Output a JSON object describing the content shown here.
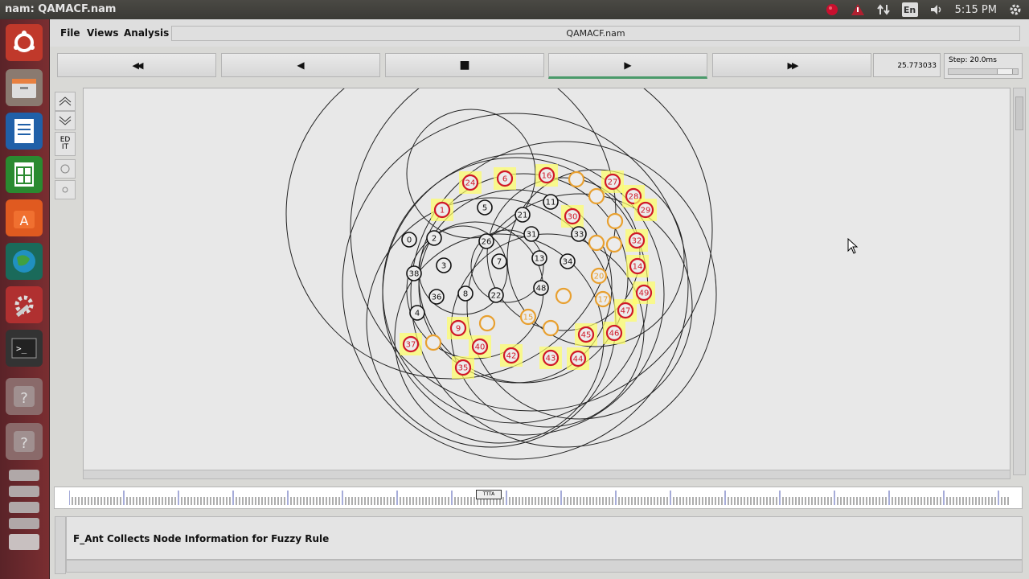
{
  "window_title": "nam: QAMACF.nam",
  "tray": {
    "language": "En",
    "clock": "5:15 PM"
  },
  "menu": {
    "file": "File",
    "views": "Views",
    "analysis": "Analysis"
  },
  "file_name": "QAMACF.nam",
  "controls": {
    "rewind": "◀◀",
    "back": "◀",
    "stop": "■",
    "play": "▶",
    "fast_forward": "▶▶"
  },
  "time_value": "25.773033",
  "step_label": "Step: 20.0ms",
  "tools": {
    "edit": "ED IT"
  },
  "timeline_marker": "TTTA",
  "annotation": "F_Ant Collects Node Information for Fuzzy Rule",
  "colors": {
    "red_node": "#d01828",
    "orange_node": "#e8a030",
    "black_node": "#111111",
    "highlight": "#ffff66",
    "play_active": "#4a9a6a"
  },
  "nodes": [
    {
      "id": "24",
      "type": "red"
    },
    {
      "id": "6",
      "type": "red"
    },
    {
      "id": "16",
      "type": "red"
    },
    {
      "id": "",
      "type": "orange"
    },
    {
      "id": "27",
      "type": "red"
    },
    {
      "id": "28",
      "type": "red"
    },
    {
      "id": "29",
      "type": "red"
    },
    {
      "id": "1",
      "type": "red"
    },
    {
      "id": "5",
      "type": "black"
    },
    {
      "id": "11",
      "type": "black"
    },
    {
      "id": "30",
      "type": "red"
    },
    {
      "id": "",
      "type": "orange"
    },
    {
      "id": "0",
      "type": "black"
    },
    {
      "id": "2",
      "type": "black"
    },
    {
      "id": "26",
      "type": "black"
    },
    {
      "id": "21",
      "type": "black"
    },
    {
      "id": "31",
      "type": "black"
    },
    {
      "id": "33",
      "type": "black"
    },
    {
      "id": "32",
      "type": "red"
    },
    {
      "id": "",
      "type": "orange"
    },
    {
      "id": "3",
      "type": "black"
    },
    {
      "id": "7",
      "type": "black"
    },
    {
      "id": "13",
      "type": "black"
    },
    {
      "id": "34",
      "type": "black"
    },
    {
      "id": "14",
      "type": "red"
    },
    {
      "id": "38",
      "type": "black"
    },
    {
      "id": "20",
      "type": "orange"
    },
    {
      "id": "8",
      "type": "black"
    },
    {
      "id": "36",
      "type": "black"
    },
    {
      "id": "22",
      "type": "black"
    },
    {
      "id": "48",
      "type": "black"
    },
    {
      "id": "49",
      "type": "red"
    },
    {
      "id": "",
      "type": "orange"
    },
    {
      "id": "17",
      "type": "orange"
    },
    {
      "id": "47",
      "type": "red"
    },
    {
      "id": "4",
      "type": "black"
    },
    {
      "id": "15",
      "type": "orange"
    },
    {
      "id": "9",
      "type": "red"
    },
    {
      "id": "",
      "type": "orange"
    },
    {
      "id": "",
      "type": "orange"
    },
    {
      "id": "45",
      "type": "red"
    },
    {
      "id": "46",
      "type": "red"
    },
    {
      "id": "37",
      "type": "red"
    },
    {
      "id": "",
      "type": "orange"
    },
    {
      "id": "40",
      "type": "red"
    },
    {
      "id": "42",
      "type": "red"
    },
    {
      "id": "43",
      "type": "red"
    },
    {
      "id": "44",
      "type": "red"
    },
    {
      "id": "35",
      "type": "red"
    },
    {
      "id": "",
      "type": "orange"
    },
    {
      "id": "",
      "type": "orange"
    }
  ]
}
